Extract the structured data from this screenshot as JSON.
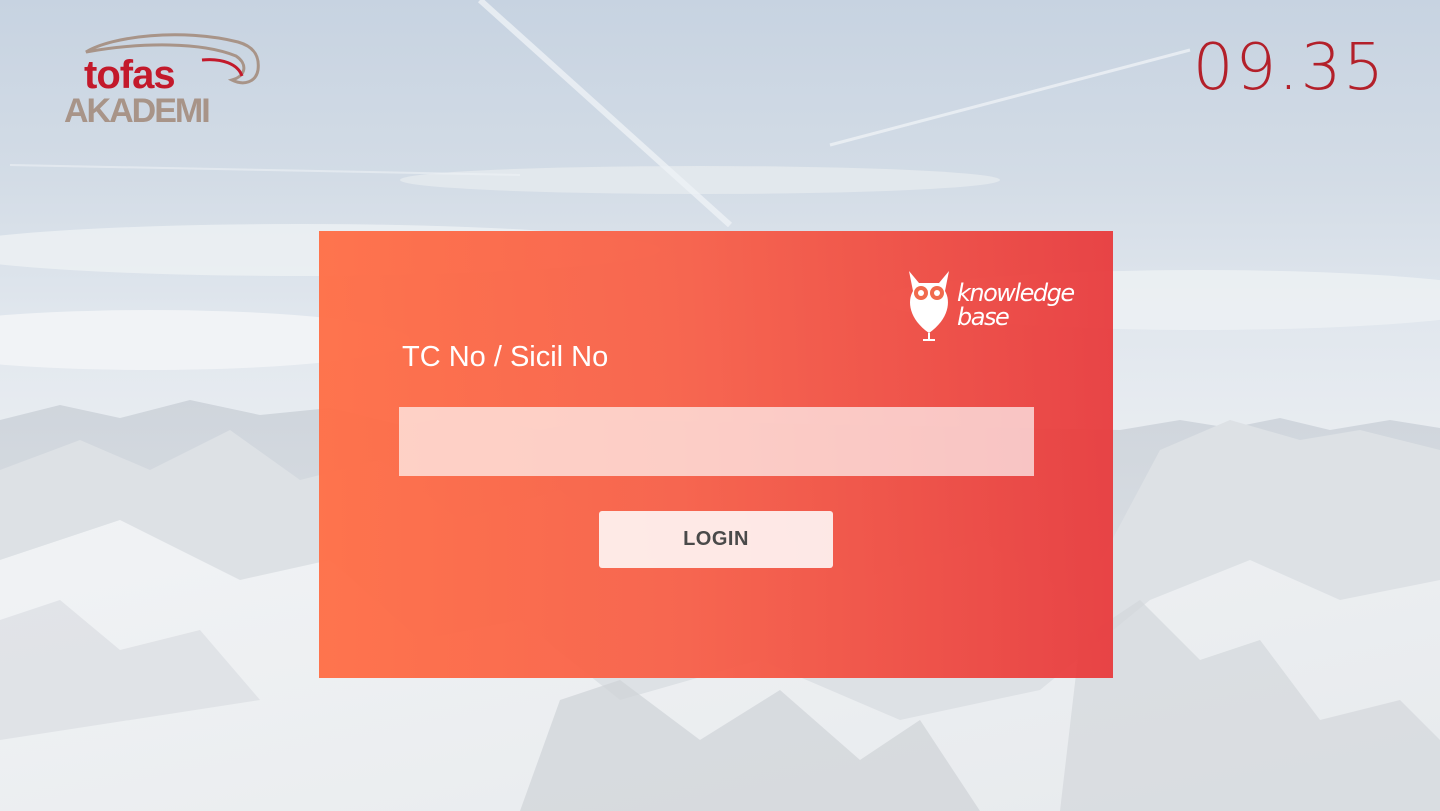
{
  "header": {
    "clock": "09.35",
    "accent_color": "#b3202a"
  },
  "logo": {
    "name": "tofas-akademi-logo",
    "line1": "tofas",
    "line2": "AKADEMI"
  },
  "login_card": {
    "brand_logo": "knowledge-base-owl-logo",
    "brand_line1": "knowledge",
    "brand_line2": "base",
    "field_label": "TC No / Sicil No",
    "field_value": "",
    "field_placeholder": "",
    "login_label": "LOGIN",
    "gradient_start": "#ff7048",
    "gradient_end": "#e83a3c"
  },
  "background": {
    "icon": "snowy-mountains-image"
  }
}
